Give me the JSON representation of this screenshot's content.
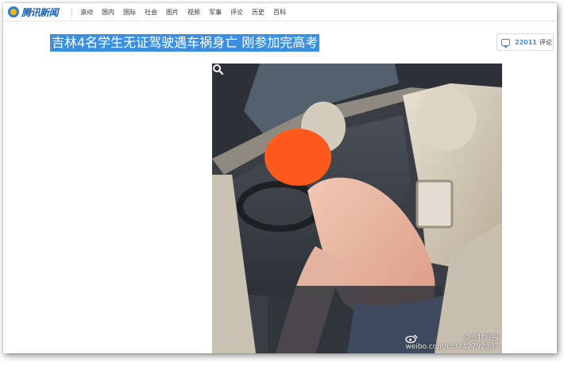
{
  "header": {
    "logo_text": "腾讯新闻",
    "nav": [
      "滚动",
      "国内",
      "国际",
      "社会",
      "图片",
      "视频",
      "军事",
      "评论",
      "历史",
      "百科"
    ]
  },
  "article": {
    "title": "吉林4名学生无证驾驶遇车祸身亡 刚参加完高考",
    "comment_count": "22011",
    "comment_label": "评论"
  },
  "photo": {
    "watermark_handle": "@吉林日报",
    "watermark_url": "weibo.com/u/3242792887"
  },
  "colors": {
    "accent": "#3b8fe0",
    "brand_blue": "#1a5fb4",
    "hair_orange": "#ff5a1e"
  },
  "icons": {
    "logo": "tencent-news-logo",
    "comment": "speech-bubble-icon",
    "zoom": "magnifier-icon",
    "weibo": "weibo-icon"
  }
}
